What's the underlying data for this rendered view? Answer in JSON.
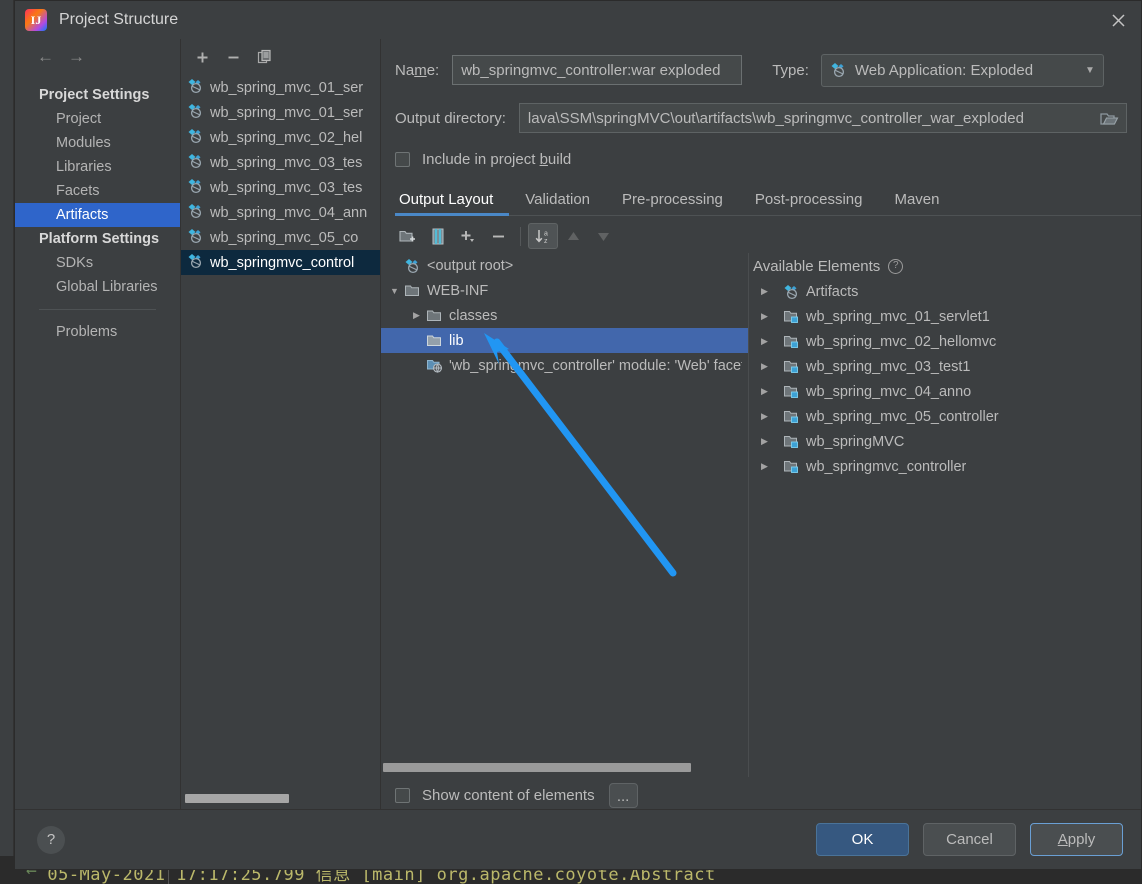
{
  "window": {
    "title": "Project Structure",
    "app_icon": "intellij-idea-icon",
    "close_icon": "close-icon"
  },
  "sidebar": {
    "nav": {
      "back_icon": "arrow-left-icon",
      "forward_icon": "arrow-right-icon"
    },
    "groups": [
      {
        "label": "Project Settings",
        "items": [
          {
            "label": "Project",
            "selected": false
          },
          {
            "label": "Modules",
            "selected": false
          },
          {
            "label": "Libraries",
            "selected": false
          },
          {
            "label": "Facets",
            "selected": false
          },
          {
            "label": "Artifacts",
            "selected": true
          }
        ]
      },
      {
        "label": "Platform Settings",
        "items": [
          {
            "label": "SDKs",
            "selected": false
          },
          {
            "label": "Global Libraries",
            "selected": false
          }
        ]
      }
    ],
    "problems": {
      "label": "Problems"
    }
  },
  "artifacts_panel": {
    "toolbar": [
      {
        "name": "add-artifact-button",
        "icon": "plus-icon"
      },
      {
        "name": "remove-artifact-button",
        "icon": "minus-icon"
      },
      {
        "name": "copy-artifact-button",
        "icon": "copy-icon"
      }
    ],
    "items": [
      {
        "label": "wb_spring_mvc_01_ser",
        "icon": "artifact-icon",
        "selected": false
      },
      {
        "label": "wb_spring_mvc_01_ser",
        "icon": "artifact-icon",
        "selected": false
      },
      {
        "label": "wb_spring_mvc_02_hel",
        "icon": "artifact-icon",
        "selected": false
      },
      {
        "label": "wb_spring_mvc_03_tes",
        "icon": "artifact-icon",
        "selected": false
      },
      {
        "label": "wb_spring_mvc_03_tes",
        "icon": "artifact-icon",
        "selected": false
      },
      {
        "label": "wb_spring_mvc_04_ann",
        "icon": "artifact-icon",
        "selected": false
      },
      {
        "label": "wb_spring_mvc_05_co",
        "icon": "artifact-icon",
        "selected": false
      },
      {
        "label": "wb_springmvc_control",
        "icon": "artifact-icon",
        "selected": true
      }
    ]
  },
  "detail": {
    "name_label": "Name:",
    "name_label_mnemonic": "m",
    "name_value": "wb_springmvc_controller:war exploded",
    "type_label": "Type:",
    "type_value": "Web Application: Exploded",
    "type_icon": "artifact-icon",
    "type_caret": "chevron-down-icon",
    "output_dir_label": "Output directory:",
    "output_dir_value": "lava\\SSM\\springMVC\\out\\artifacts\\wb_springmvc_controller_war_exploded",
    "output_dir_browse_icon": "folder-open-icon",
    "include_in_build_label": "Include in project build",
    "include_in_build_mnemonic": "b",
    "include_in_build_checked": false
  },
  "tabs": [
    {
      "label": "Output Layout",
      "active": true
    },
    {
      "label": "Validation",
      "active": false
    },
    {
      "label": "Pre-processing",
      "active": false
    },
    {
      "label": "Post-processing",
      "active": false
    },
    {
      "label": "Maven",
      "active": false
    }
  ],
  "layout_toolbar": [
    {
      "name": "add-directory-button",
      "icon": "folder-add-icon",
      "state": "normal"
    },
    {
      "name": "add-archive-button",
      "icon": "archive-icon",
      "state": "normal"
    },
    {
      "name": "add-element-button",
      "icon": "plus-dropdown-icon",
      "state": "normal"
    },
    {
      "name": "remove-element-button",
      "icon": "minus-icon",
      "state": "normal"
    },
    {
      "name": "sort-button",
      "icon": "sort-az-icon",
      "state": "pressed"
    },
    {
      "name": "move-up-button",
      "icon": "arrow-up-icon",
      "state": "disabled"
    },
    {
      "name": "move-down-button",
      "icon": "arrow-down-icon",
      "state": "disabled"
    }
  ],
  "output_layout_tree": [
    {
      "label": "<output root>",
      "icon": "artifact-icon",
      "indent": 0,
      "twisty": "none",
      "selected": false
    },
    {
      "label": "WEB-INF",
      "icon": "folder-icon",
      "indent": 1,
      "twisty": "expanded",
      "selected": false
    },
    {
      "label": "classes",
      "icon": "folder-icon",
      "indent": 2,
      "twisty": "collapsed",
      "selected": false
    },
    {
      "label": "lib",
      "icon": "folder-icon",
      "indent": 2,
      "twisty": "none",
      "selected": true
    },
    {
      "label": "'wb_springmvc_controller' module: 'Web' facet",
      "icon": "web-facet-icon",
      "indent": 2,
      "twisty": "none",
      "selected": false
    }
  ],
  "available_elements": {
    "title": "Available Elements",
    "help_icon": "help-circle-icon",
    "items": [
      {
        "label": "Artifacts",
        "icon": "artifact-icon",
        "twisty": "collapsed"
      },
      {
        "label": "wb_spring_mvc_01_servlet1",
        "icon": "module-icon",
        "twisty": "collapsed"
      },
      {
        "label": "wb_spring_mvc_02_hellomvc",
        "icon": "module-icon",
        "twisty": "collapsed"
      },
      {
        "label": "wb_spring_mvc_03_test1",
        "icon": "module-icon",
        "twisty": "collapsed"
      },
      {
        "label": "wb_spring_mvc_04_anno",
        "icon": "module-icon",
        "twisty": "collapsed"
      },
      {
        "label": "wb_spring_mvc_05_controller",
        "icon": "module-icon",
        "twisty": "collapsed"
      },
      {
        "label": "wb_springMVC",
        "icon": "module-icon",
        "twisty": "collapsed"
      },
      {
        "label": "wb_springmvc_controller",
        "icon": "module-icon",
        "twisty": "collapsed"
      }
    ]
  },
  "show_content": {
    "label": "Show content of elements",
    "checked": false,
    "more_button_label": "..."
  },
  "footer": {
    "help_label": "?",
    "buttons": [
      {
        "label": "OK",
        "style": "primary"
      },
      {
        "label": "Cancel",
        "style": "normal"
      },
      {
        "label": "Apply",
        "style": "focused",
        "mnemonic": "A"
      }
    ]
  },
  "background": {
    "console_arrow": "←",
    "console_line": "05-May-2021 17:17:25.799 信息 [main] org.apache.coyote.Abstract"
  },
  "colors": {
    "dialog_bg": "#3c3f41",
    "selection_blue": "#4267ac",
    "sidebar_selection": "#2f65ca",
    "inactive_selection": "#0d293e",
    "primary_button": "#365880",
    "tab_underline": "#4a88c7",
    "annotation_arrow": "#2196f3",
    "console_text": "#bbb86a"
  }
}
